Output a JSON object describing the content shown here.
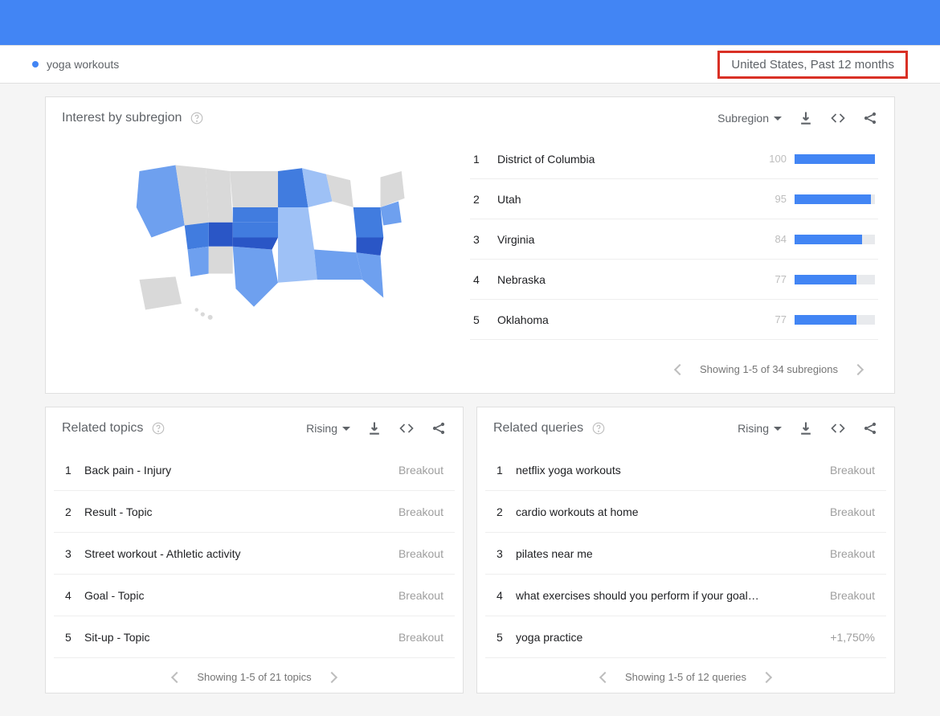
{
  "filter_bar": {
    "term": "yoga workouts",
    "scope": "United States, Past 12 months"
  },
  "subregion_card": {
    "title": "Interest by subregion",
    "dropdown": "Subregion",
    "rows": [
      {
        "rank": "1",
        "name": "District of Columbia",
        "value": 100
      },
      {
        "rank": "2",
        "name": "Utah",
        "value": 95
      },
      {
        "rank": "3",
        "name": "Virginia",
        "value": 84
      },
      {
        "rank": "4",
        "name": "Nebraska",
        "value": 77
      },
      {
        "rank": "5",
        "name": "Oklahoma",
        "value": 77
      }
    ],
    "pager": "Showing 1-5 of 34 subregions"
  },
  "related_topics": {
    "title": "Related topics",
    "dropdown": "Rising",
    "rows": [
      {
        "rank": "1",
        "label": "Back pain - Injury",
        "metric": "Breakout"
      },
      {
        "rank": "2",
        "label": "Result - Topic",
        "metric": "Breakout"
      },
      {
        "rank": "3",
        "label": "Street workout - Athletic activity",
        "metric": "Breakout"
      },
      {
        "rank": "4",
        "label": "Goal - Topic",
        "metric": "Breakout"
      },
      {
        "rank": "5",
        "label": "Sit-up - Topic",
        "metric": "Breakout"
      }
    ],
    "pager": "Showing 1-5 of 21 topics"
  },
  "related_queries": {
    "title": "Related queries",
    "dropdown": "Rising",
    "rows": [
      {
        "rank": "1",
        "label": "netflix yoga workouts",
        "metric": "Breakout"
      },
      {
        "rank": "2",
        "label": "cardio workouts at home",
        "metric": "Breakout"
      },
      {
        "rank": "3",
        "label": "pilates near me",
        "metric": "Breakout"
      },
      {
        "rank": "4",
        "label": "what exercises should you perform if your goal…",
        "metric": "Breakout"
      },
      {
        "rank": "5",
        "label": "yoga practice",
        "metric": "+1,750%"
      }
    ],
    "pager": "Showing 1-5 of 12 queries"
  }
}
